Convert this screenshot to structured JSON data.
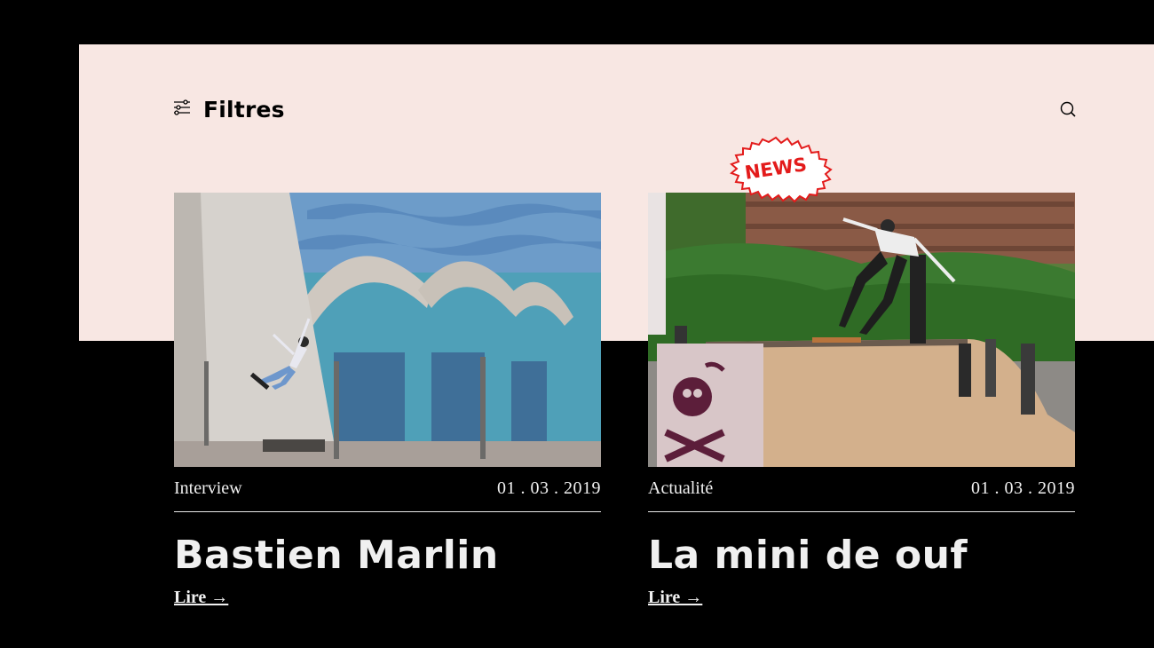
{
  "colors": {
    "background": "#000000",
    "panel": "#f8e7e3",
    "text": "#f0f0f0",
    "badge_red": "#e31b1b"
  },
  "header": {
    "filters_label": "Filtres",
    "filters_icon": "sliders-icon",
    "search_icon": "search-icon"
  },
  "badge": {
    "label": "NEWS"
  },
  "cards": [
    {
      "category": "Interview",
      "date": "01 . 03 . 2019",
      "title": "Bastien Marlin",
      "link_label": "Lire →",
      "image": "skateboarder-wallride-photo"
    },
    {
      "category": "Actualité",
      "date": "01 . 03 . 2019",
      "title": "La mini de ouf",
      "link_label": "Lire →",
      "image": "miniramp-grind-photo"
    }
  ]
}
